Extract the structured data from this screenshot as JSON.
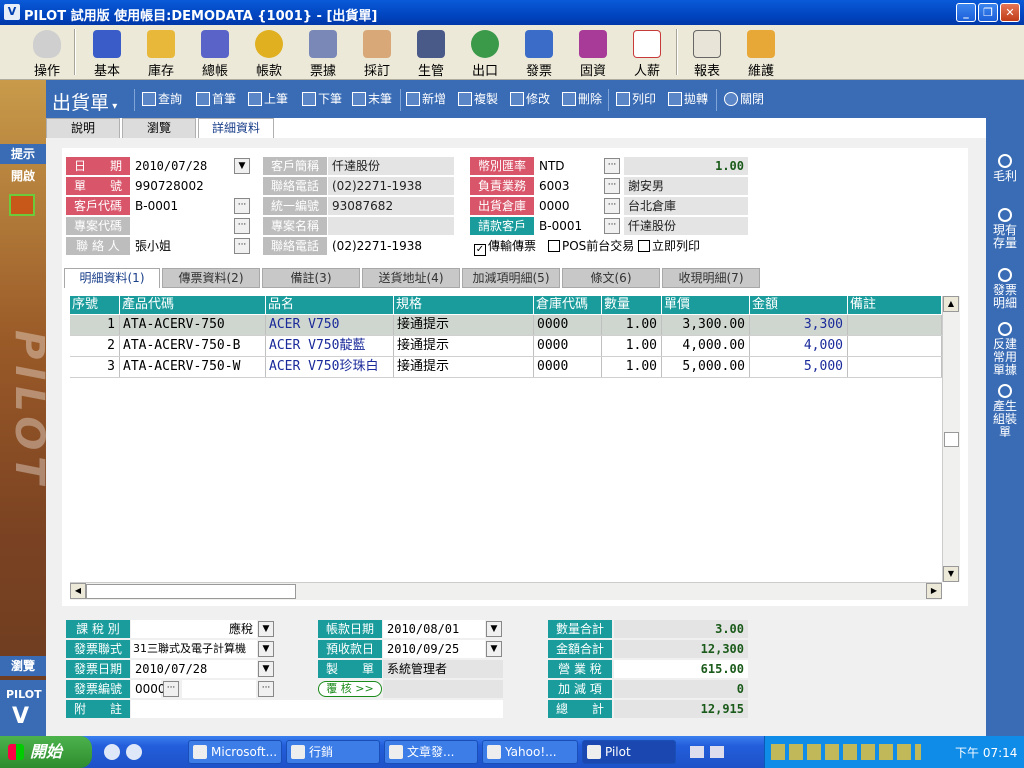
{
  "window": {
    "title": "PILOT 試用版  使用帳目:DEMODATA {1001} - [出貨單]",
    "logo": "V"
  },
  "modules": [
    "操作",
    "基本",
    "庫存",
    "總帳",
    "帳款",
    "票據",
    "採訂",
    "生管",
    "出口",
    "發票",
    "固資",
    "人薪",
    "報表",
    "維護"
  ],
  "left": {
    "tip": "提示",
    "open": "開啟",
    "browse": "瀏覽",
    "brand": "PILOT",
    "watermark": "PILOT"
  },
  "toolbar": {
    "doc_title": "出貨單",
    "query": "查詢",
    "first": "首筆",
    "prev": "上筆",
    "next": "下筆",
    "last": "末筆",
    "add": "新增",
    "copy": "複製",
    "edit": "修改",
    "delete": "刪除",
    "print": "列印",
    "transfer": "拋轉",
    "close": "關閉"
  },
  "page_tabs": [
    "說明",
    "瀏覽",
    "詳細資料"
  ],
  "right_sidebar": [
    "毛利",
    "現有存量",
    "發票明細",
    "反建常用單據",
    "產生組裝單"
  ],
  "header": {
    "date_label": "日　　期",
    "date": "2010/07/28",
    "number_label": "單　　號",
    "number": "990728002",
    "cust_code_label": "客戶代碼",
    "cust_code": "B-0001",
    "project_label": "專案代碼",
    "project": "",
    "contact_label": "聯 絡 人",
    "contact": "張小姐",
    "cust_name_label": "客戶簡稱",
    "cust_name": "仟達股份",
    "phone_label": "聯絡電話",
    "phone": "(02)2271-1938",
    "taxid_label": "統一編號",
    "taxid": "93087682",
    "project_name_label": "專案名稱",
    "project_name": "",
    "phone2_label": "聯絡電話",
    "phone2": "(02)2271-1938",
    "currency_label": "幣別匯率",
    "currency": "NTD",
    "rate": "1.00",
    "sales_label": "負責業務",
    "sales_code": "6003",
    "sales_name": "謝安男",
    "warehouse_label": "出貨倉庫",
    "warehouse_code": "0000",
    "warehouse_name": "台北倉庫",
    "billing_label": "請款客戶",
    "billing_code": "B-0001",
    "billing_name": "仟達股份",
    "chk_transmit": "傳輸傳票",
    "chk_pos": "POS前台交易",
    "chk_print": "立即列印"
  },
  "detail_tabs": [
    "明細資料(1)",
    "傳票資料(2)",
    "備註(3)",
    "送貨地址(4)",
    "加減項明細(5)",
    "條文(6)",
    "收現明細(7)"
  ],
  "grid": {
    "columns": [
      "序號",
      "產品代碼",
      "品名",
      "規格",
      "倉庫代碼",
      "數量",
      "單價",
      "金額",
      "備註"
    ],
    "rows": [
      {
        "no": "1",
        "code": "ATA-ACERV-750",
        "name": "ACER V750",
        "spec": "接通提示",
        "wh": "0000",
        "qty": "1.00",
        "price": "3,300.00",
        "amount": "3,300",
        "note": ""
      },
      {
        "no": "2",
        "code": "ATA-ACERV-750-B",
        "name": "ACER V750靛藍",
        "spec": "接通提示",
        "wh": "0000",
        "qty": "1.00",
        "price": "4,000.00",
        "amount": "4,000",
        "note": ""
      },
      {
        "no": "3",
        "code": "ATA-ACERV-750-W",
        "name": "ACER V750珍珠白",
        "spec": "接通提示",
        "wh": "0000",
        "qty": "1.00",
        "price": "5,000.00",
        "amount": "5,000",
        "note": ""
      }
    ]
  },
  "footer": {
    "tax_type_label": "課 稅 別",
    "tax_type": "應稅",
    "invoice_form_label": "發票聯式",
    "invoice_form": "31三聯式及電子計算機",
    "invoice_date_label": "發票日期",
    "invoice_date": "2010/07/28",
    "invoice_no_label": "發票編號",
    "invoice_no": "0000",
    "memo_label": "附　　註",
    "memo": "",
    "ledger_date_label": "帳款日期",
    "ledger_date": "2010/08/01",
    "due_date_label": "預收款日",
    "due_date": "2010/09/25",
    "maker_label": "製　　單",
    "maker": "系統管理者",
    "review_label": "覆 核 >>",
    "qty_total_label": "數量合計",
    "qty_total": "3.00",
    "amount_total_label": "金額合計",
    "amount_total": "12,300",
    "vat_label": "營 業 稅",
    "vat": "615.00",
    "adj_label": "加 減 項",
    "adj": "0",
    "grand_label": "總　　計",
    "grand": "12,915"
  },
  "taskbar": {
    "start": "開始",
    "items": [
      "Microsoft...",
      "行銷",
      "文章發...",
      "Yahoo!...",
      "Pilot"
    ],
    "clock": "下午 07:14"
  }
}
